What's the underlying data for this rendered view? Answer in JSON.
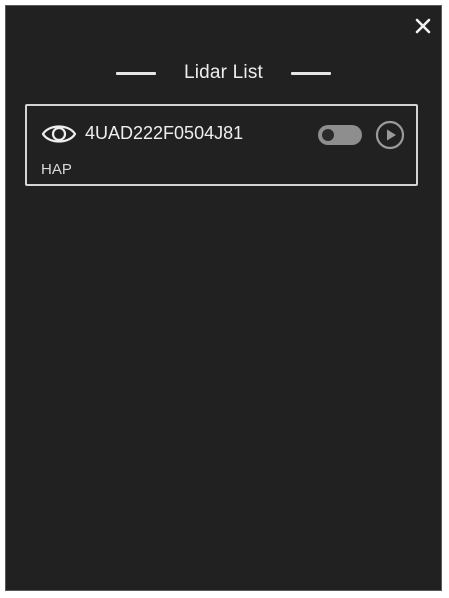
{
  "panel": {
    "title": "Lidar List",
    "close_icon": "close-icon"
  },
  "lidars": [
    {
      "id": "4UAD222F0504J81",
      "type": "HAP",
      "visible_icon": "eye-icon",
      "enabled": false,
      "play_icon": "play-circle-icon"
    }
  ],
  "colors": {
    "background": "#212121",
    "text": "#eeeeee",
    "card_border": "#d4d4d4",
    "toggle_off": "#8e8e8e"
  }
}
